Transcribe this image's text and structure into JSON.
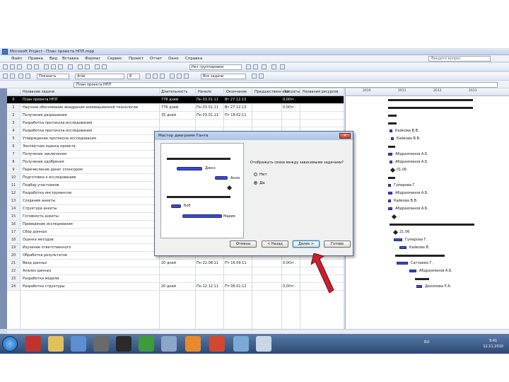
{
  "window": {
    "title": "Microsoft Project - План проекта НПП.mpp"
  },
  "menu": {
    "items": [
      "Файл",
      "Правка",
      "Вид",
      "Вставка",
      "Формат",
      "Сервис",
      "Проект",
      "Отчет",
      "Окно",
      "Справка"
    ],
    "help_placeholder": "Введите вопрос"
  },
  "toolbar": {
    "view_selector": "Нет группировки",
    "font": "Arial",
    "font_size": "8",
    "show_selector": "Показать",
    "filter": "Все задачи"
  },
  "entry_bar": {
    "value": "План проекта НПП"
  },
  "table": {
    "headers": {
      "name": "Название задачи",
      "duration": "Длительность",
      "start": "Начало",
      "finish": "Окончание",
      "predecessors": "Предшественники",
      "cost": "Затраты",
      "resources": "Названия ресурсов"
    },
    "rows": [
      {
        "id": "0",
        "name": "План проекта НПП",
        "duration": "776 дней",
        "start": "Пн 03.01.11",
        "finish": "Вт 27.12.13",
        "pred": "",
        "cost": "0,00тг.",
        "res": "",
        "style": "black"
      },
      {
        "id": "1",
        "name": "Научное обоснование внедрения инновационной технологии",
        "duration": "776 дней",
        "start": "Пн 03.01.11",
        "finish": "Вт 27.12.13",
        "pred": "",
        "cost": "0,00тг.",
        "res": ""
      },
      {
        "id": "2",
        "name": "Получение разрешения",
        "duration": "35 дней",
        "start": "Пн 03.01.11",
        "finish": "Пт 18.02.11",
        "pred": "",
        "cost": "",
        "res": ""
      },
      {
        "id": "3",
        "name": "Разработка протокола исследования",
        "duration": "",
        "start": "",
        "finish": "",
        "pred": "",
        "cost": "",
        "res": ""
      },
      {
        "id": "4",
        "name": "Разработка протокола исследования",
        "duration": "",
        "start": "",
        "finish": "",
        "pred": "",
        "cost": "",
        "res": ""
      },
      {
        "id": "5",
        "name": "Утверждение протокола исследования",
        "duration": "",
        "start": "",
        "finish": "",
        "pred": "",
        "cost": "",
        "res": ""
      },
      {
        "id": "6",
        "name": "Экспертная оценка проекта",
        "duration": "",
        "start": "",
        "finish": "",
        "pred": "",
        "cost": "",
        "res": ""
      },
      {
        "id": "7",
        "name": "Получение заключения",
        "duration": "",
        "start": "",
        "finish": "",
        "pred": "",
        "cost": "",
        "res": ""
      },
      {
        "id": "8",
        "name": "Получение одобрения",
        "duration": "",
        "start": "",
        "finish": "",
        "pred": "",
        "cost": "",
        "res": ""
      },
      {
        "id": "9",
        "name": "Перечисление денег спонсором",
        "duration": "",
        "start": "",
        "finish": "",
        "pred": "",
        "cost": "",
        "res": ""
      },
      {
        "id": "10",
        "name": "Подготовка к исследованию",
        "duration": "",
        "start": "",
        "finish": "",
        "pred": "",
        "cost": "",
        "res": ""
      },
      {
        "id": "11",
        "name": "Подбор участников",
        "duration": "",
        "start": "",
        "finish": "",
        "pred": "",
        "cost": "",
        "res": ""
      },
      {
        "id": "12",
        "name": "Разработка инструментов",
        "duration": "",
        "start": "",
        "finish": "",
        "pred": "",
        "cost": "",
        "res": ""
      },
      {
        "id": "13",
        "name": "Создание анкеты",
        "duration": "",
        "start": "",
        "finish": "",
        "pred": "",
        "cost": "",
        "res": ""
      },
      {
        "id": "14",
        "name": "Структура анкеты",
        "duration": "",
        "start": "",
        "finish": "",
        "pred": "",
        "cost": "",
        "res": ""
      },
      {
        "id": "15",
        "name": "Готовность анкеты",
        "duration": "",
        "start": "",
        "finish": "",
        "pred": "",
        "cost": "",
        "res": ""
      },
      {
        "id": "16",
        "name": "Проведение исследования",
        "duration": "",
        "start": "",
        "finish": "",
        "pred": "",
        "cost": "",
        "res": ""
      },
      {
        "id": "17",
        "name": "Сбор данных",
        "duration": "",
        "start": "",
        "finish": "",
        "pred": "",
        "cost": "",
        "res": ""
      },
      {
        "id": "18",
        "name": "Оценка методов",
        "duration": "30 дней",
        "start": "Пн 20.06.11",
        "finish": "Пт 29.07.11",
        "pred": "",
        "cost": "0,00тг.",
        "res": ""
      },
      {
        "id": "19",
        "name": "Изучение ответственного",
        "duration": "20 дней",
        "start": "Пн 25.07.11",
        "finish": "Пт 19.08.11",
        "pred": "",
        "cost": "0,00тг.",
        "res": ""
      },
      {
        "id": "20",
        "name": "Обработка результатов",
        "duration": "130 дней",
        "start": "Пн 02.05.11",
        "finish": "Пт 05.08.11",
        "pred": "",
        "cost": "0,00тг.",
        "res": ""
      },
      {
        "id": "21",
        "name": "Ввод данных",
        "duration": "20 дней",
        "start": "Пн 22.08.11",
        "finish": "Пт 16.09.11",
        "pred": "",
        "cost": "0,00тг.",
        "res": ""
      },
      {
        "id": "22",
        "name": "Анализ данных",
        "duration": "",
        "start": "",
        "finish": "",
        "pred": "",
        "cost": "",
        "res": ""
      },
      {
        "id": "23",
        "name": "Разработка модели",
        "duration": "",
        "start": "",
        "finish": "",
        "pred": "",
        "cost": "",
        "res": ""
      },
      {
        "id": "24",
        "name": "Разработка структуры",
        "duration": "20 дней",
        "start": "Пн 12.12.11",
        "finish": "Пт 06.01.12",
        "pred": "",
        "cost": "0,00тг.",
        "res": ""
      }
    ]
  },
  "gantt": {
    "ticks": [
      "2010",
      "2011",
      "2012",
      "2013"
    ],
    "labels": [
      "Кайкова В.В.",
      "Кайкова В.В.",
      "Абдрахманов А.Б.",
      "Абдрахманов А.Б.",
      "01.06",
      "Гумарова Г.",
      "Абдрахманов А.Б.",
      "Кайкова В.В.",
      "Абдрахманов А.Б.",
      "21.06",
      "Гумарова Г.",
      "Кайкова В.",
      "Сатпаева Г.",
      "Абдрахманов А.Б.",
      "Абдрахманов А.Б.",
      "Абдрахманов А.Б.",
      "Дихомова Р.А.",
      "Кайкова В.В."
    ]
  },
  "dialog": {
    "title": "Мастер диаграмм Ганта",
    "question": "Отображать связи между зависимыми задачами?",
    "options": [
      "Нет",
      "Да"
    ],
    "selected": "Да",
    "preview_labels": [
      "Джон",
      "Анна",
      "Боб",
      "Мария"
    ],
    "buttons": {
      "cancel": "Отмена",
      "back": "< Назад",
      "next": "Далее >",
      "finish": "Готово"
    }
  },
  "taskbar": {
    "time": "9:41",
    "date": "12.11.2010",
    "lang": "RU"
  },
  "colors": {
    "task_bar": "#3c4bc0",
    "summary": "#222222",
    "arrow": "#c8202e"
  }
}
